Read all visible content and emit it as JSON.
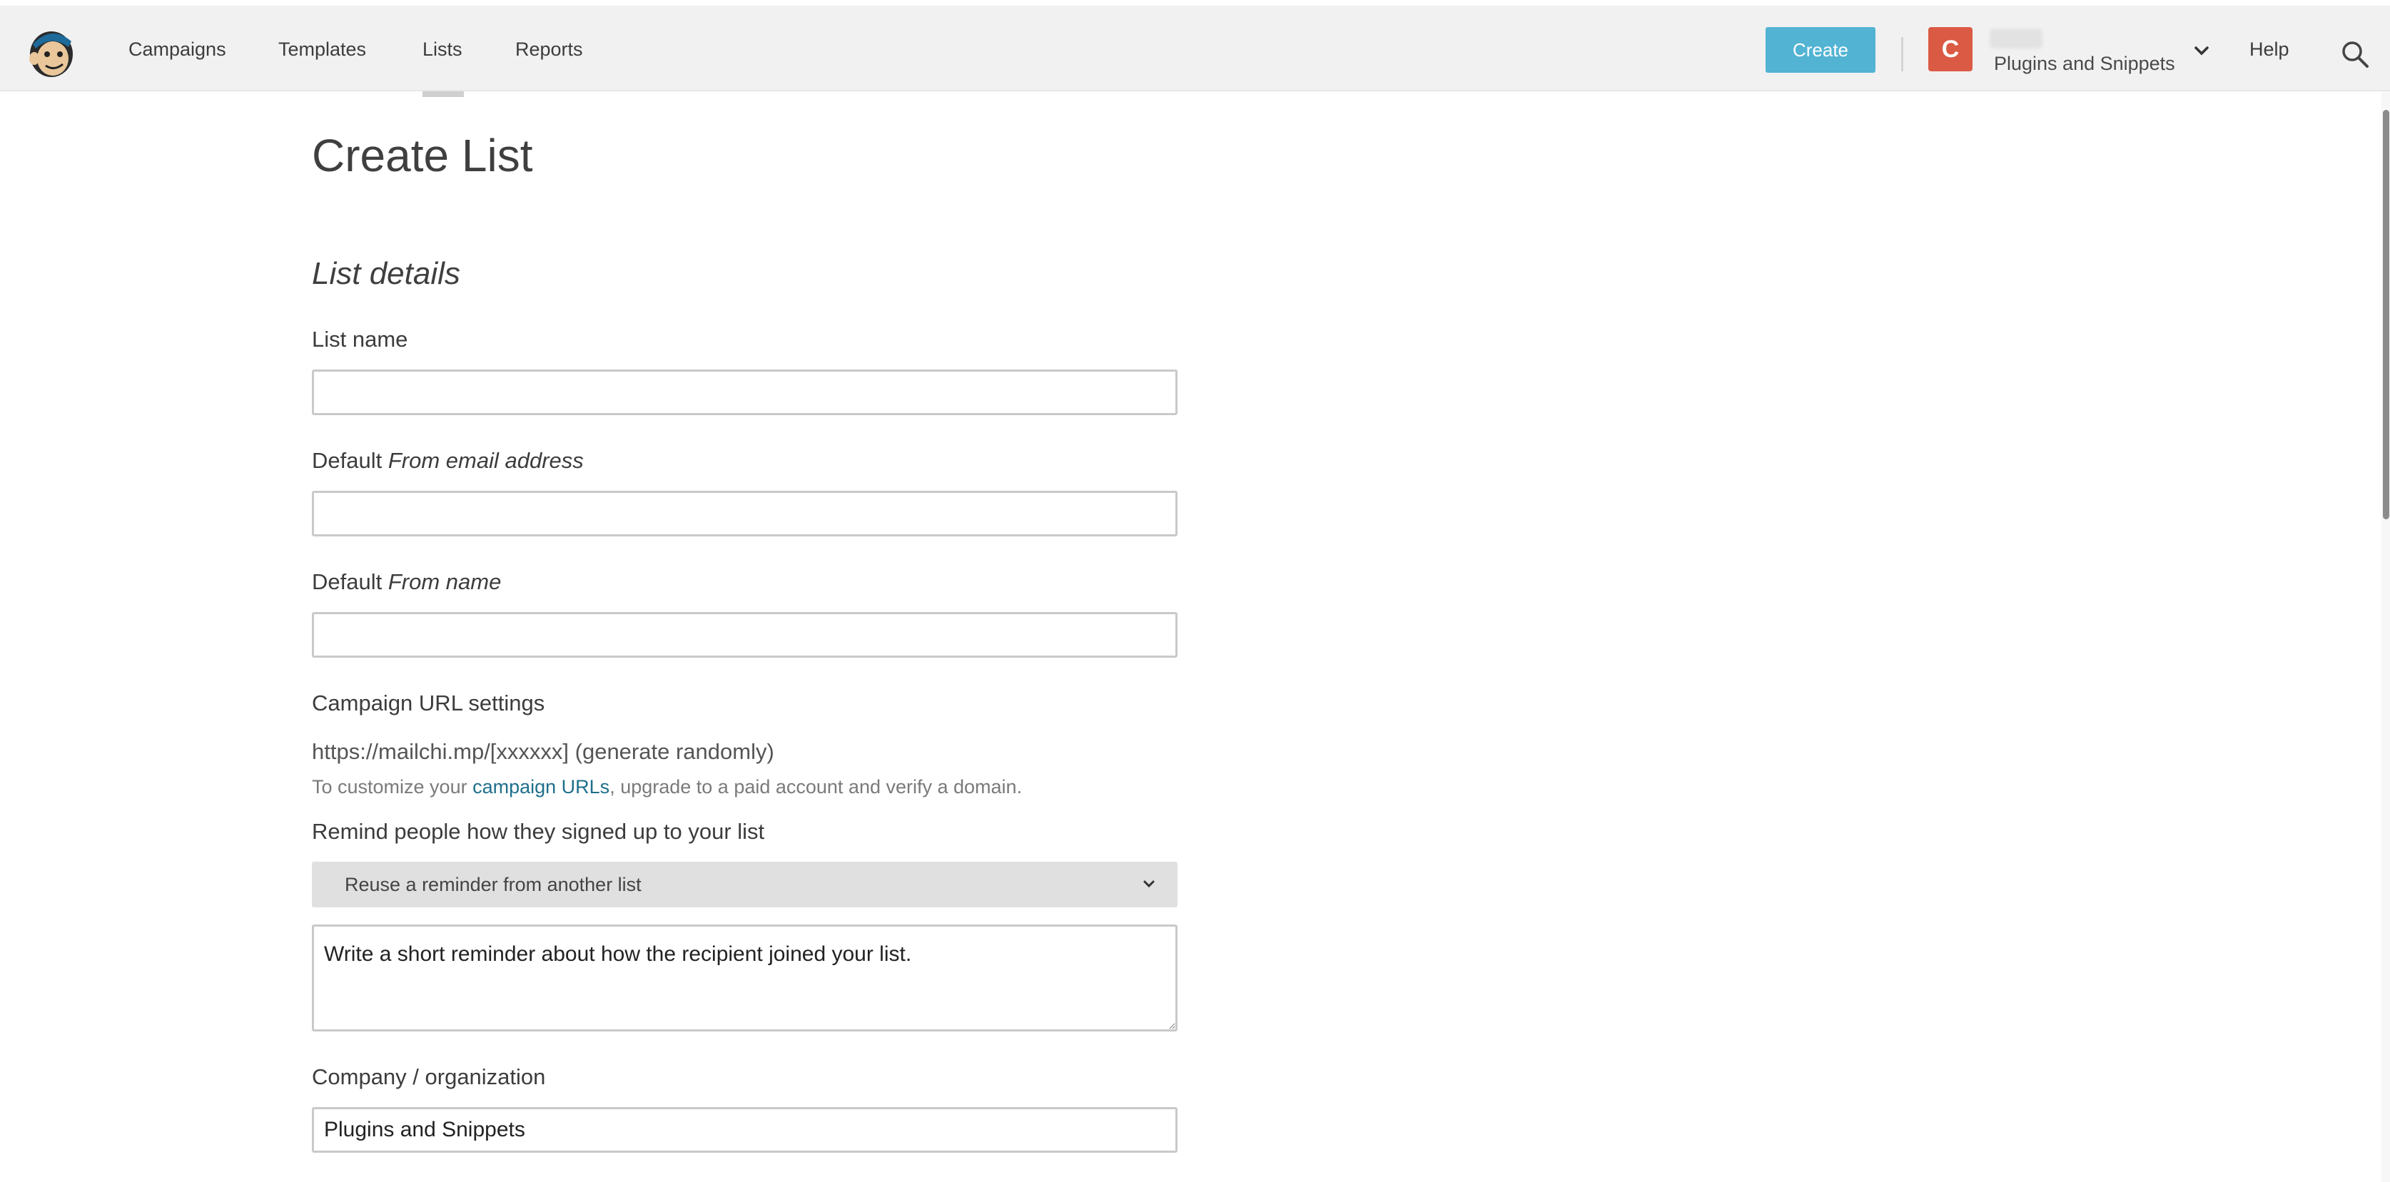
{
  "nav": {
    "links": [
      "Campaigns",
      "Templates",
      "Lists",
      "Reports"
    ],
    "active_link": "Lists",
    "create_label": "Create",
    "avatar_letter": "C",
    "account_name": "Plugins and Snippets",
    "help_label": "Help"
  },
  "page": {
    "title": "Create List",
    "section_title": "List details"
  },
  "form": {
    "list_name_label": "List name",
    "list_name_value": "",
    "from_email_label_prefix": "Default ",
    "from_email_label_em": "From email address",
    "from_email_value": "",
    "from_name_label_prefix": "Default ",
    "from_name_label_em": "From name",
    "from_name_value": "",
    "campaign_url_label": "Campaign URL settings",
    "campaign_url_value": "https://mailchi.mp/[xxxxxx] (generate randomly)",
    "help_prefix": "To customize your ",
    "help_link": "campaign URLs",
    "help_suffix": ", upgrade to a paid account and verify a domain.",
    "remind_label": "Remind people how they signed up to your list",
    "reuse_select_label": "Reuse a reminder from another list",
    "reminder_value": "Write a short reminder about how the recipient joined your list.",
    "company_label": "Company / organization",
    "company_value": "Plugins and Snippets"
  },
  "colors": {
    "create_button": "#52b3d3",
    "avatar_bg": "#db5a44",
    "link": "#1f6f8b",
    "nav_bg": "#f1f1f1"
  }
}
